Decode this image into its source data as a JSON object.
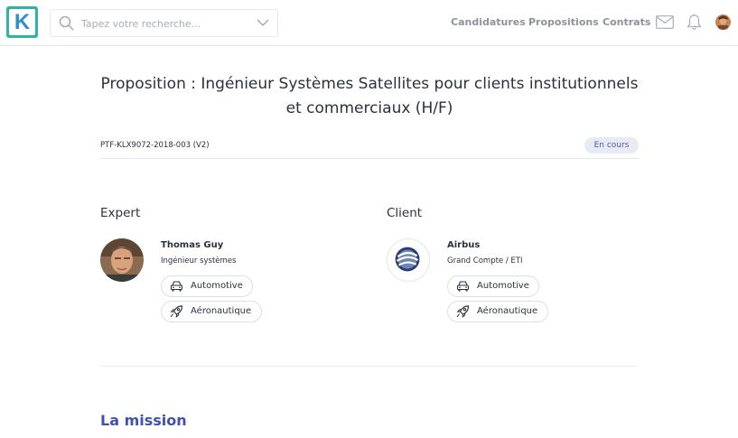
{
  "header": {
    "logo_letter": "K",
    "search_placeholder": "Tapez votre recherche...",
    "nav": [
      "Candidatures",
      "Propositions",
      "Contrats"
    ]
  },
  "proposal": {
    "title": "Proposition : Ingénieur Systèmes Satellites pour clients institutionnels et commerciaux (H/F)",
    "reference": "PTF-KLX9072-2018-003 (V2)",
    "status": "En cours"
  },
  "expert": {
    "section_title": "Expert",
    "name": "Thomas Guy",
    "role": "Ingénieur systèmes",
    "tags": [
      "Automotive",
      "Aéronautique"
    ]
  },
  "client": {
    "section_title": "Client",
    "name": "Airbus",
    "type": "Grand Compte / ETI",
    "tags": [
      "Automotive",
      "Aéronautique"
    ]
  },
  "mission": {
    "title": "La mission"
  },
  "colors": {
    "accent": "#3f51b5",
    "logo_teal": "#2fb3a6",
    "logo_blue": "#2f8fc8",
    "badge_bg": "#e8ebf4"
  },
  "icons": {
    "search": "search-icon",
    "chevron": "chevron-down-icon",
    "mail": "mail-icon",
    "bell": "bell-icon",
    "car": "car-icon",
    "rocket": "rocket-icon"
  }
}
